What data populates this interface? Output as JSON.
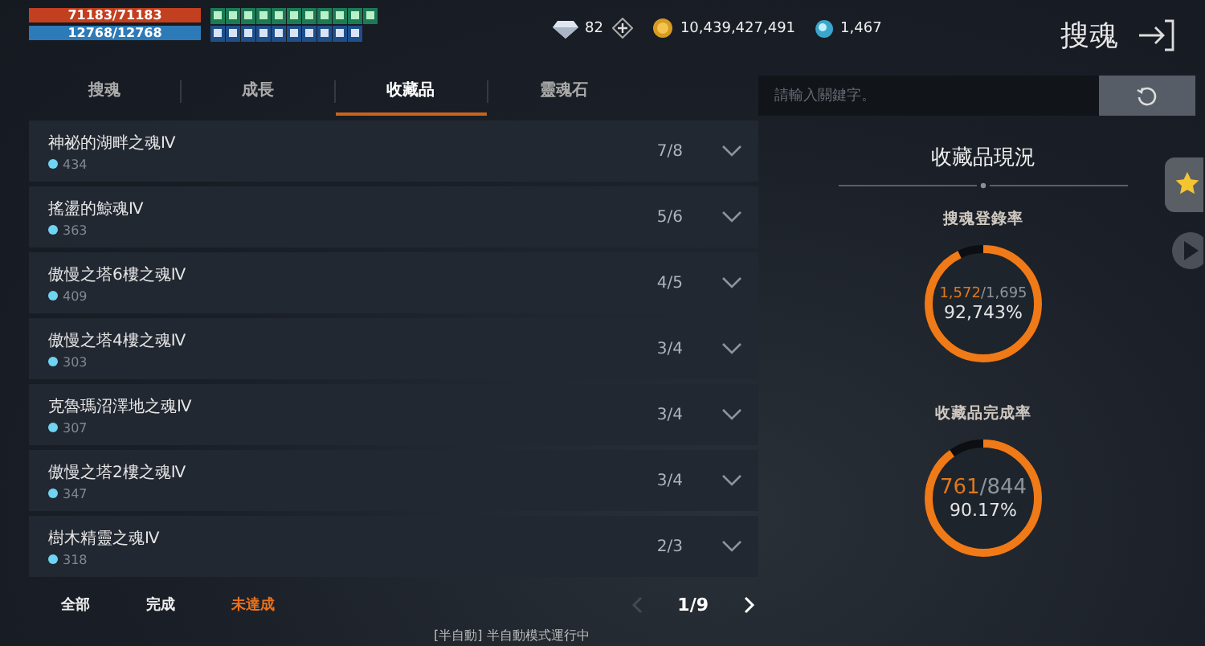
{
  "player": {
    "hp": {
      "text": "71183/71183",
      "level": 1
    },
    "mp": {
      "text": "12768/12768",
      "level": 1
    }
  },
  "currencies": [
    {
      "kind": "diamond",
      "amount": "82"
    },
    {
      "kind": "coin",
      "amount": "10,439,427,491"
    },
    {
      "kind": "gem",
      "amount": "1,467"
    }
  ],
  "title": "搜魂",
  "tabs": [
    {
      "label": "搜魂",
      "selected": false
    },
    {
      "label": "成長",
      "selected": false
    },
    {
      "label": "收藏品",
      "selected": true
    },
    {
      "label": "靈魂石",
      "selected": false
    }
  ],
  "search": {
    "placeholder": "請輸入關鍵字。"
  },
  "items": [
    {
      "name": "神祕的湖畔之魂Ⅳ",
      "points": "434",
      "progress": "7/8"
    },
    {
      "name": "搖盪的鯨魂Ⅳ",
      "points": "363",
      "progress": "5/6"
    },
    {
      "name": "傲慢之塔6樓之魂Ⅳ",
      "points": "409",
      "progress": "4/5"
    },
    {
      "name": "傲慢之塔4樓之魂Ⅳ",
      "points": "303",
      "progress": "3/4"
    },
    {
      "name": "克魯瑪沼澤地之魂Ⅳ",
      "points": "307",
      "progress": "3/4"
    },
    {
      "name": "傲慢之塔2樓之魂Ⅳ",
      "points": "347",
      "progress": "3/4"
    },
    {
      "name": "樹木精靈之魂Ⅳ",
      "points": "318",
      "progress": "2/3"
    }
  ],
  "filters": [
    {
      "label": "全部",
      "selected": false
    },
    {
      "label": "完成",
      "selected": false
    },
    {
      "label": "未達成",
      "selected": true
    }
  ],
  "pager": {
    "page": "1/9",
    "prev_disabled": true,
    "next_disabled": false
  },
  "status": "[半自動] 半自動模式運行中",
  "summary": {
    "title": "收藏品現況",
    "stats": [
      {
        "label": "搜魂登錄率",
        "count": "1,572",
        "total": "/1,695",
        "percent": "92,743%",
        "level": 0.927
      },
      {
        "label": "收藏品完成率",
        "count": "761",
        "total": "/844",
        "percent": "90.17%",
        "level": 0.9017
      }
    ]
  }
}
